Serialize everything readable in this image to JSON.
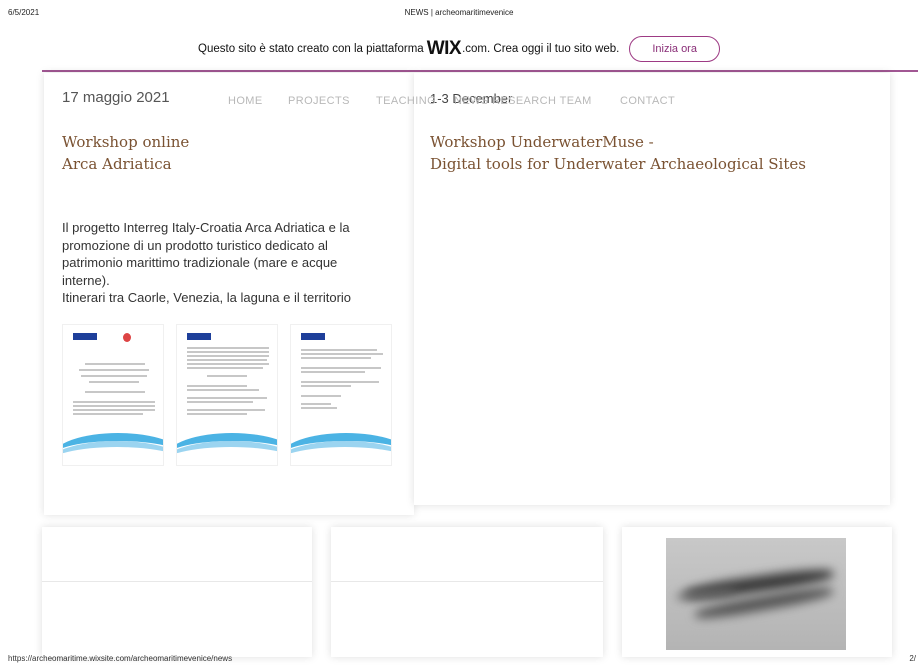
{
  "print": {
    "date": "6/5/2021",
    "title": "NEWS | archeomaritimevenice",
    "url": "https://archeomaritime.wixsite.com/archeomaritimevenice/news",
    "page": "2/"
  },
  "wix_banner": {
    "text_before": "Questo sito è stato creato con la piattaforma",
    "logo": "WIX",
    "text_after": ".com. Crea oggi il tuo sito web.",
    "cta": "Inizia ora",
    "accent_color": "#a15793"
  },
  "nav": {
    "items": [
      "HOME",
      "PROJECTS",
      "TEACHING",
      "NEWS",
      "RESEARCH TEAM",
      "CONTACT"
    ]
  },
  "posts": [
    {
      "date": "17 maggio 2021",
      "title_line1": "Workshop online",
      "title_line2": "Arca Adriatica",
      "body_line1": "Il progetto Interreg Italy-Croatia Arca Adriatica e la",
      "body_line2": "promozione di un prodotto turistico dedicato al",
      "body_line3": "patrimonio marittimo tradizionale (mare e acque",
      "body_line4": "interne).",
      "body_line5": "Itinerari tra Caorle, Venezia, la laguna e il territorio"
    },
    {
      "date": "1-3 December",
      "title_line1": "Workshop UnderwaterMuse -",
      "title_line2": "Digital tools for Underwater Archaeological Sites"
    }
  ],
  "colors": {
    "title_brown": "#7a5232",
    "nav_gray": "#b8b8b8"
  }
}
